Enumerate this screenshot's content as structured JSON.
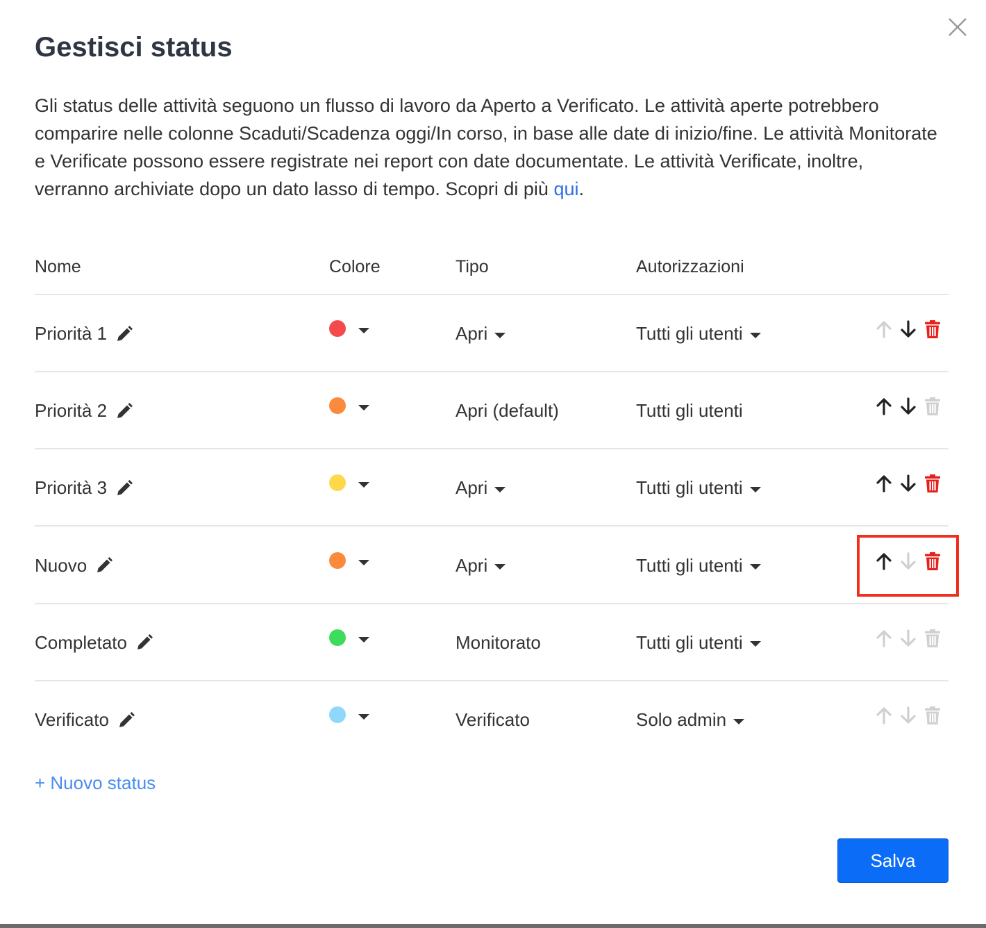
{
  "dialog": {
    "title": "Gestisci status",
    "description": "Gli status delle attività seguono un flusso di lavoro da Aperto a Verificato. Le attività aperte potrebbero comparire nelle colonne Scaduti/Scadenza oggi/In corso, in base alle date di inizio/fine. Le attività Monitorate e Verificate possono essere registrate nei report con date documentate. Le attività Verificate, inoltre, verranno archiviate dopo un dato lasso di tempo. Scopri di più ",
    "learn_more_link": "qui",
    "description_end": ".",
    "close_icon": "close-icon"
  },
  "table": {
    "headers": {
      "name": "Nome",
      "color": "Colore",
      "type": "Tipo",
      "permissions": "Autorizzazioni"
    },
    "rows": [
      {
        "name": "Priorità 1",
        "color": "#f44a4e",
        "type": "Apri",
        "type_dropdown": true,
        "permissions": "Tutti gli utenti",
        "perm_dropdown": true,
        "up_enabled": false,
        "down_enabled": true,
        "delete_enabled": true
      },
      {
        "name": "Priorità 2",
        "color": "#fb8a3c",
        "type": "Apri (default)",
        "type_dropdown": false,
        "permissions": "Tutti gli utenti",
        "perm_dropdown": false,
        "up_enabled": true,
        "down_enabled": true,
        "delete_enabled": false
      },
      {
        "name": "Priorità 3",
        "color": "#fdd84a",
        "type": "Apri",
        "type_dropdown": true,
        "permissions": "Tutti gli utenti",
        "perm_dropdown": true,
        "up_enabled": true,
        "down_enabled": true,
        "delete_enabled": true
      },
      {
        "name": "Nuovo",
        "color": "#fb8a3c",
        "type": "Apri",
        "type_dropdown": true,
        "permissions": "Tutti gli utenti",
        "perm_dropdown": true,
        "up_enabled": true,
        "down_enabled": false,
        "delete_enabled": true
      },
      {
        "name": "Completato",
        "color": "#3ddc5a",
        "type": "Monitorato",
        "type_dropdown": false,
        "permissions": "Tutti gli utenti",
        "perm_dropdown": true,
        "up_enabled": false,
        "down_enabled": false,
        "delete_enabled": false
      },
      {
        "name": "Verificato",
        "color": "#8fd8fb",
        "type": "Verificato",
        "type_dropdown": false,
        "permissions": "Solo admin",
        "perm_dropdown": true,
        "up_enabled": false,
        "down_enabled": false,
        "delete_enabled": false
      }
    ]
  },
  "add_status_label": "+ Nuovo status",
  "save_label": "Salva",
  "colors": {
    "accent": "#0b6cf7",
    "link": "#2f6fe8",
    "delete_active": "#e8201c",
    "icon_active": "#222222",
    "icon_disabled": "#d0d0d0",
    "highlight": "#f0301f"
  }
}
